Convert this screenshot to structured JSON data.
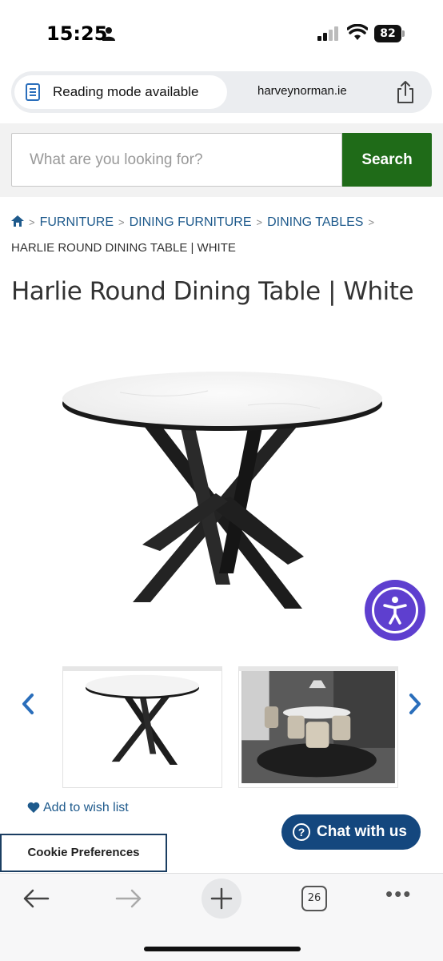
{
  "status_bar": {
    "time": "15:25",
    "battery": "82"
  },
  "browser": {
    "reading_mode": "Reading mode available",
    "domain": "harveynorman.ie",
    "open_tabs": "26"
  },
  "search": {
    "placeholder": "What are you looking for?",
    "button_label": "Search"
  },
  "breadcrumb": {
    "items": [
      "FURNITURE",
      "DINING FURNITURE",
      "DINING TABLES"
    ],
    "current": "HARLIE ROUND DINING TABLE | WHITE"
  },
  "product": {
    "title": "Harlie Round Dining Table | White",
    "wishlist_label": "Add to wish list"
  },
  "chat": {
    "label": "Chat with us"
  },
  "cookie": {
    "label": "Cookie Preferences"
  },
  "colors": {
    "search_button": "#1f6b18",
    "link": "#1e5a8c",
    "chat_button": "#14477e",
    "accessibility": "#5e3fcf"
  },
  "icons": [
    "person-icon",
    "signal-icon",
    "wifi-icon",
    "battery-icon",
    "reading-mode-icon",
    "share-icon",
    "home-icon",
    "chevron-right-icon",
    "chevron-left-icon",
    "accessibility-icon",
    "heart-icon",
    "help-circle-icon",
    "back-arrow-icon",
    "forward-arrow-icon",
    "plus-icon",
    "tabs-icon",
    "more-icon"
  ]
}
